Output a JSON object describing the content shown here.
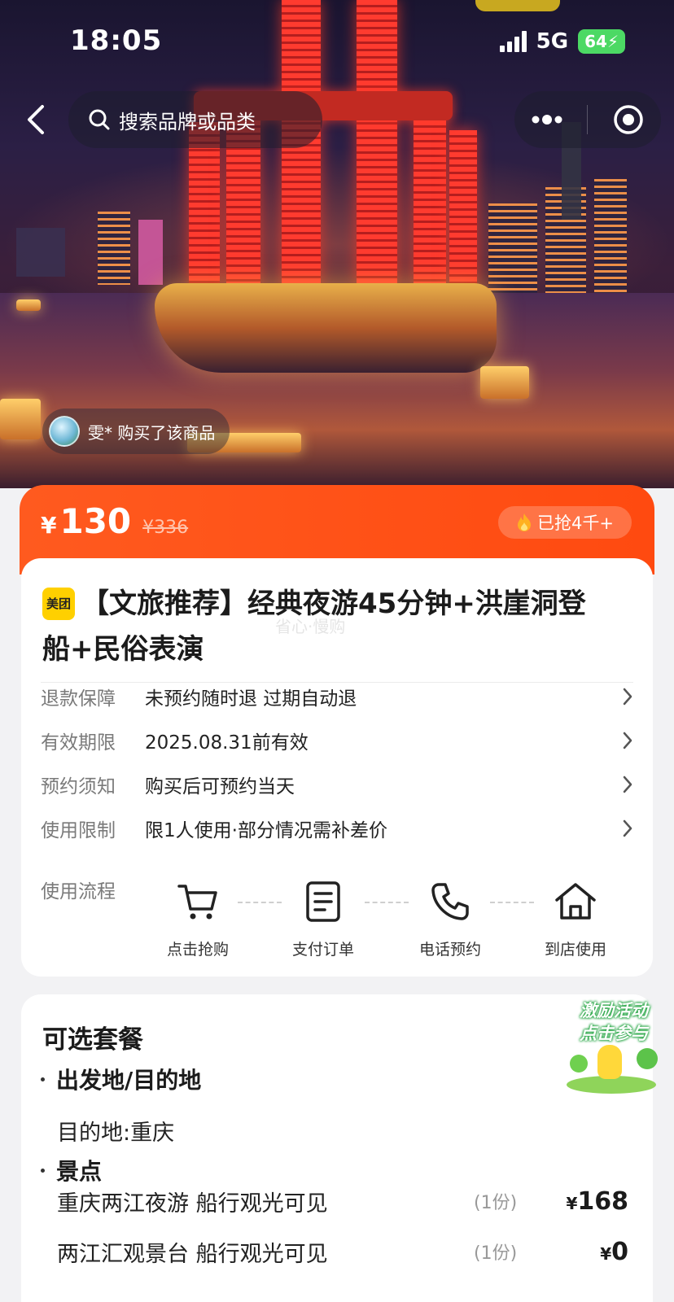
{
  "status_bar": {
    "time": "18:05",
    "network": "5G",
    "battery": "64"
  },
  "nav": {
    "search_placeholder": "搜索品牌或品类"
  },
  "hero": {
    "buyer_notice": "雯* 购买了该商品"
  },
  "price": {
    "currency": "¥",
    "current": "130",
    "original": "¥336",
    "sold": "已抢4千+"
  },
  "product": {
    "brand_badge": "美团",
    "title": "【文旅推荐】经典夜游45分钟+洪崖洞登船+民俗表演",
    "watermark": "省心·慢购"
  },
  "info_rows": [
    {
      "label": "退款保障",
      "value": "未预约随时退 过期自动退"
    },
    {
      "label": "有效期限",
      "value": "2025.08.31前有效"
    },
    {
      "label": "预约须知",
      "value": "购买后可预约当天"
    },
    {
      "label": "使用限制",
      "value": "限1人使用·部分情况需补差价"
    }
  ],
  "usage_flow": {
    "label": "使用流程",
    "steps": [
      {
        "label": "点击抢购",
        "icon": "cart-icon"
      },
      {
        "label": "支付订单",
        "icon": "document-icon"
      },
      {
        "label": "电话预约",
        "icon": "phone-icon"
      },
      {
        "label": "到店使用",
        "icon": "home-icon"
      }
    ]
  },
  "packages": {
    "title": "可选套餐",
    "sections": [
      {
        "heading": "出发地/目的地",
        "text": "目的地:重庆"
      },
      {
        "heading": "景点"
      }
    ],
    "items": [
      {
        "name": "重庆两江夜游 船行观光可见",
        "qty": "(1份)",
        "currency": "¥",
        "price": "168"
      },
      {
        "name": "两江汇观景台 船行观光可见",
        "qty": "(1份)",
        "currency": "¥",
        "price": "0"
      }
    ]
  },
  "promo": {
    "line1": "激励活动",
    "line2": "点击参与"
  },
  "colors": {
    "accent": "#ff5a1f",
    "brand_yellow": "#ffd000",
    "battery_green": "#4cd964"
  }
}
